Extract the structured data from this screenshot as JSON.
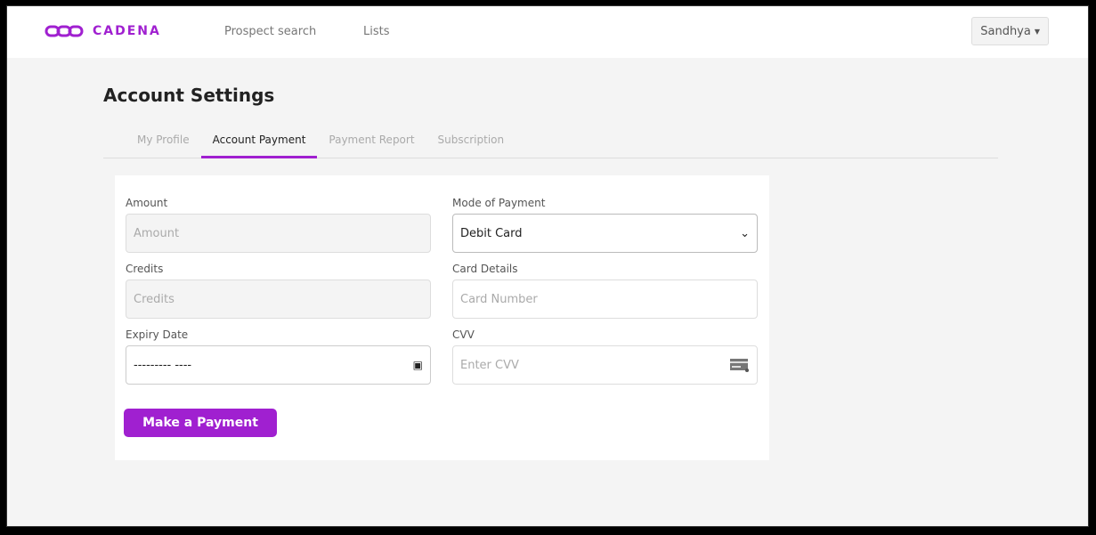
{
  "brand": {
    "name": "CADENA",
    "color": "#a020d0"
  },
  "nav": {
    "links": [
      "Prospect search",
      "Lists"
    ],
    "user": "Sandhya"
  },
  "page": {
    "title": "Account Settings"
  },
  "tabs": [
    {
      "label": "My Profile"
    },
    {
      "label": "Account Payment",
      "active": true
    },
    {
      "label": "Payment Report"
    },
    {
      "label": "Subscription"
    }
  ],
  "form": {
    "amount": {
      "label": "Amount",
      "placeholder": "Amount"
    },
    "mode": {
      "label": "Mode of Payment",
      "value": "Debit Card"
    },
    "credits": {
      "label": "Credits",
      "placeholder": "Credits"
    },
    "card": {
      "label": "Card Details",
      "placeholder": "Card Number"
    },
    "expiry": {
      "label": "Expiry Date",
      "value": "--------- ----"
    },
    "cvv": {
      "label": "CVV",
      "placeholder": "Enter CVV"
    },
    "submit": "Make a Payment"
  }
}
